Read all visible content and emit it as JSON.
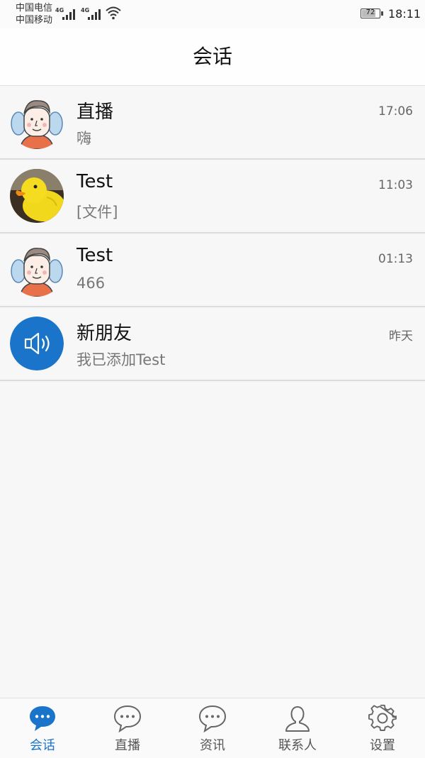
{
  "status": {
    "carrier1": "中国电信",
    "carrier2": "中国移动",
    "net1": "4G",
    "net2": "4G",
    "battery": "72",
    "time": "18:11"
  },
  "header": {
    "title": "会话"
  },
  "conversations": [
    {
      "name": "直播",
      "time": "17:06",
      "preview": "嗨",
      "avatar": "cartoon-man-avatar"
    },
    {
      "name": "Test",
      "time": "11:03",
      "preview": "[文件]",
      "avatar": "rubber-duck-avatar"
    },
    {
      "name": "Test",
      "time": "01:13",
      "preview": "466",
      "avatar": "cartoon-man-avatar"
    },
    {
      "name": "新朋友",
      "time": "昨天",
      "preview": "我已添加Test",
      "avatar": "speaker-avatar"
    }
  ],
  "tabs": [
    {
      "label": "会话",
      "icon": "chat-bubble-icon",
      "active": true
    },
    {
      "label": "直播",
      "icon": "chat-bubble-icon"
    },
    {
      "label": "资讯",
      "icon": "chat-bubble-icon"
    },
    {
      "label": "联系人",
      "icon": "person-icon"
    },
    {
      "label": "设置",
      "icon": "gear-icon"
    }
  ],
  "colors": {
    "accent": "#1a74c9",
    "speakerBg": "#1a74c9"
  }
}
